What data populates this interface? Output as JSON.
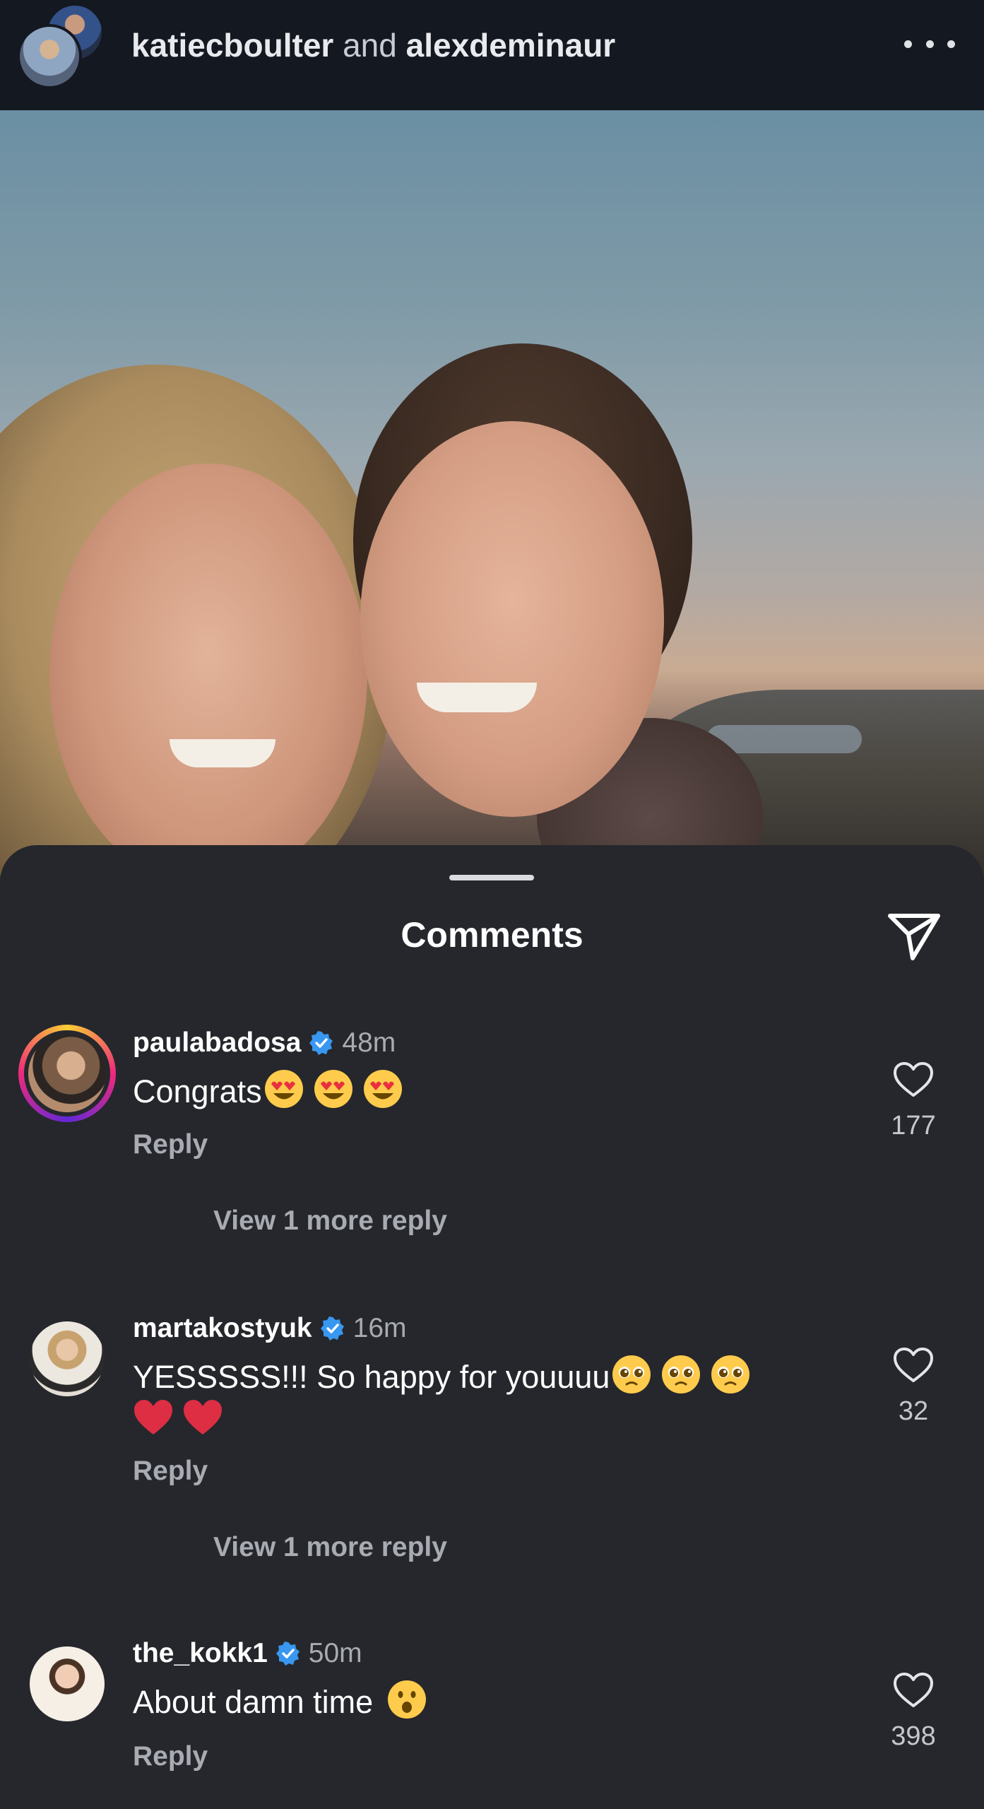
{
  "header": {
    "user1": "katiecboulter",
    "joiner": "and",
    "user2": "alexdeminaur",
    "more_icon": "more-horizontal-icon"
  },
  "sheet": {
    "title": "Comments",
    "share_icon": "send-icon"
  },
  "comments": [
    {
      "username": "paulabadosa",
      "verified": true,
      "time": "48m",
      "text": "Congrats",
      "emojis": [
        "heart-eyes",
        "heart-eyes",
        "heart-eyes"
      ],
      "reply_label": "Reply",
      "view_more": "View 1 more reply",
      "likes": "177",
      "has_story": true
    },
    {
      "username": "martakostyuk",
      "verified": true,
      "time": "16m",
      "text": "YESSSSS!!! So happy for youuuu",
      "emojis": [
        "pleading-face",
        "pleading-face",
        "pleading-face",
        "red-heart",
        "red-heart"
      ],
      "reply_label": "Reply",
      "view_more": "View 1 more reply",
      "likes": "32",
      "has_story": false
    },
    {
      "username": "the_kokk1",
      "verified": true,
      "time": "50m",
      "text": "About damn time",
      "emojis": [
        "hushed-face"
      ],
      "reply_label": "Reply",
      "likes": "398",
      "has_story": false
    }
  ],
  "colors": {
    "background": "#25272c",
    "header_bg": "#141820",
    "verified_blue": "#3897f0",
    "secondary_text": "#a8abb2"
  }
}
